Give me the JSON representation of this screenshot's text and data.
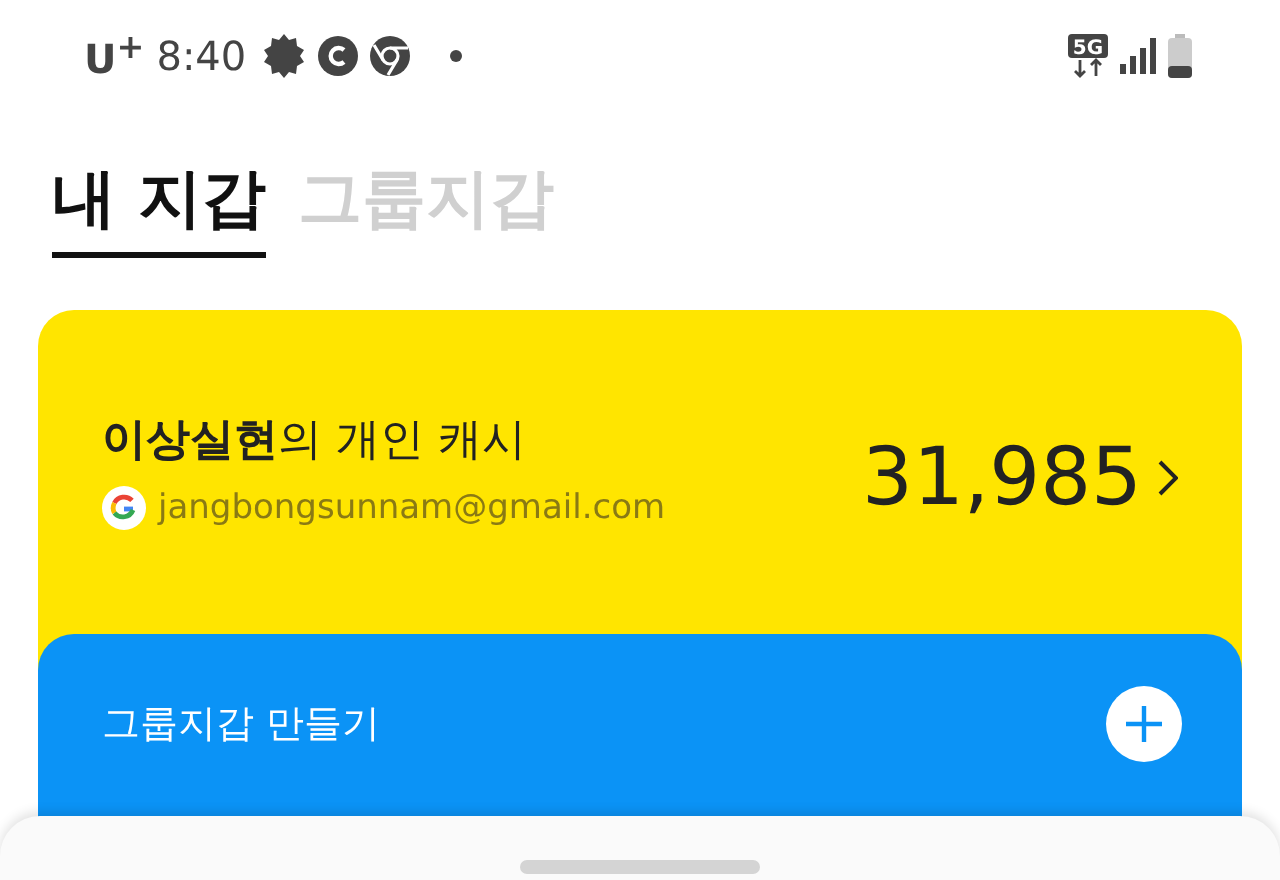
{
  "status_bar": {
    "carrier": "U$^{+}$",
    "time": "8:40",
    "network": "5G"
  },
  "tabs": [
    {
      "label": "내 지갑",
      "selected": true
    },
    {
      "label": "그룹지갑",
      "selected": false
    }
  ],
  "wallet_card": {
    "title": "**이상실현**의 개인 캐시",
    "email": "jangbongsunnam@gmail.com",
    "balance": "31,985"
  },
  "group_card": {
    "label": "그룹지갑 만들기"
  }
}
